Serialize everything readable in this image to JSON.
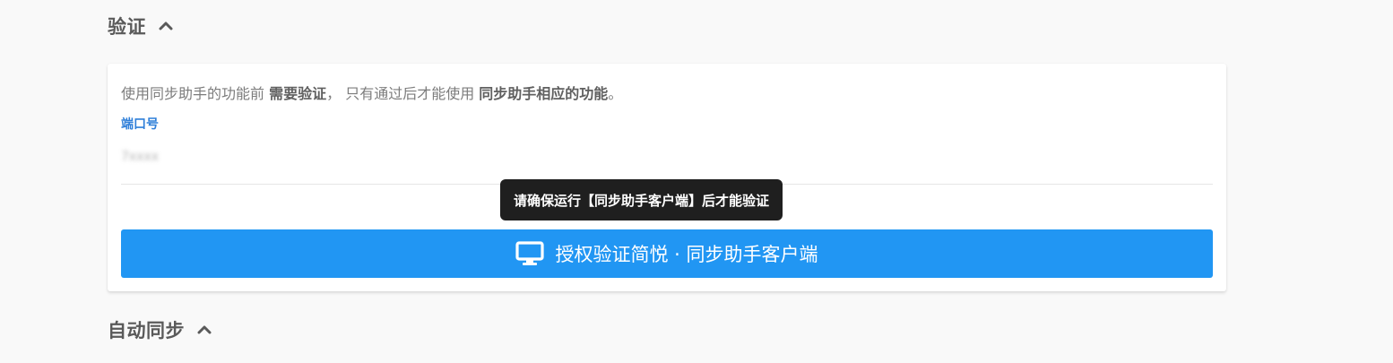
{
  "sections": {
    "verify_title": "验证",
    "autosync_title": "自动同步"
  },
  "card": {
    "desc_part1": "使用同步助手的功能前 ",
    "desc_bold1": "需要验证",
    "desc_part2": "， 只有通过后才能使用 ",
    "desc_bold2": "同步助手相应的功能",
    "desc_part3": "。",
    "port_label": "端口号",
    "port_value": "7xxxx"
  },
  "tooltip": {
    "text": "请确保运行【同步助手客户端】后才能验证"
  },
  "button": {
    "label": "授权验证简悦 · 同步助手客户端",
    "icon": "monitor-icon"
  },
  "colors": {
    "accent": "#2196f3",
    "link": "#2f7fd9",
    "tooltip_bg": "#1f1f1f"
  }
}
